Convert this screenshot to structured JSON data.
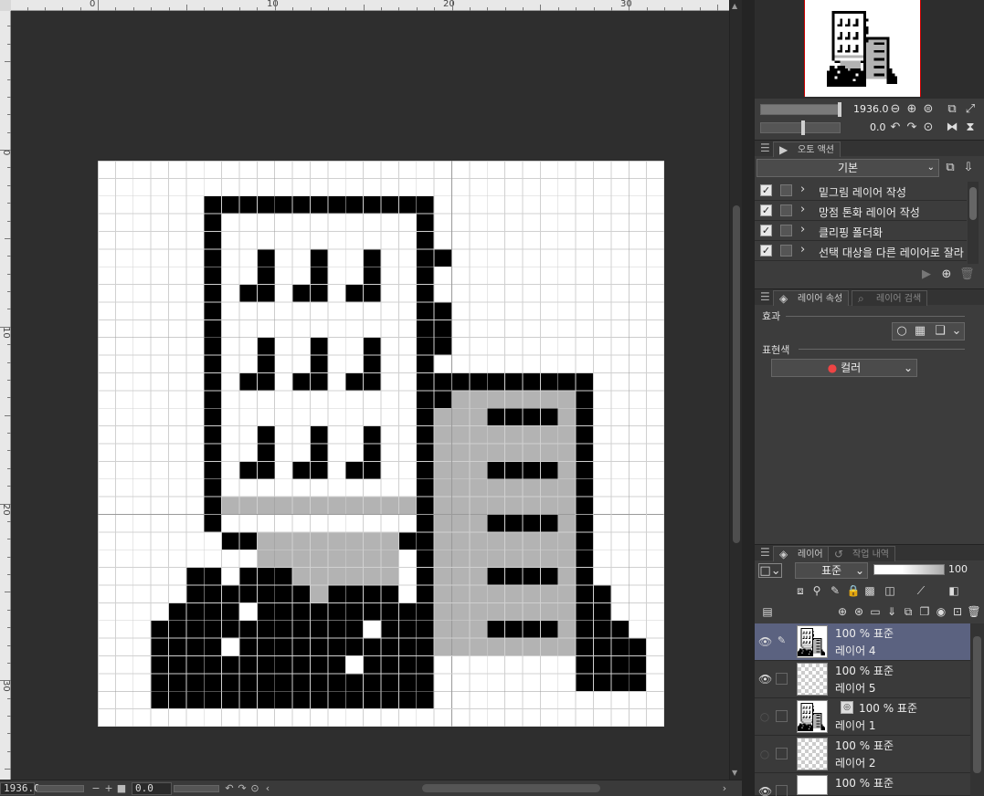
{
  "ruler": {
    "top_labels": [
      "0",
      "10",
      "20",
      "30"
    ],
    "left_labels": [
      "0",
      "10",
      "20",
      "30"
    ]
  },
  "navigator": {
    "zoom_value": "1936.0",
    "rotate_value": "0.0"
  },
  "auto_action": {
    "tab_label": "오토 액션",
    "set_name": "기본",
    "items": [
      {
        "label": "밑그림 레이어 작성",
        "checked": true
      },
      {
        "label": "망점 톤화 레이어 작성",
        "checked": true
      },
      {
        "label": "클리핑 폴더화",
        "checked": true
      },
      {
        "label": "선택 대상을 다른 레이어로 잘라",
        "checked": true
      }
    ]
  },
  "layer_property": {
    "tab_label": "레이어 속성",
    "tab2_label": "레이어 검색",
    "effect_label": "효과",
    "expression_color_label": "표현색",
    "color_value": "컬러"
  },
  "layer_panel": {
    "tab_label": "레이어",
    "tab2_label": "작업 내역",
    "blend_mode": "표준",
    "opacity": "100",
    "layers": [
      {
        "mode": "100 % 표준",
        "name": "레이어 4",
        "visible": true,
        "selected": true
      },
      {
        "mode": "100 % 표준",
        "name": "레이어 5",
        "visible": true,
        "selected": false
      },
      {
        "mode": "100 % 표준",
        "name": "레이어 1",
        "visible": false,
        "selected": false
      },
      {
        "mode": "100 % 표준",
        "name": "레이어 2",
        "visible": false,
        "selected": false
      },
      {
        "mode": "100 % 표준",
        "name": "",
        "visible": true,
        "selected": false
      }
    ]
  },
  "statusbar": {
    "zoom": "1936.0",
    "angle": "0.0"
  },
  "icons": {
    "eye": "eye-icon",
    "pen": "pen-icon",
    "play": "play-icon"
  }
}
